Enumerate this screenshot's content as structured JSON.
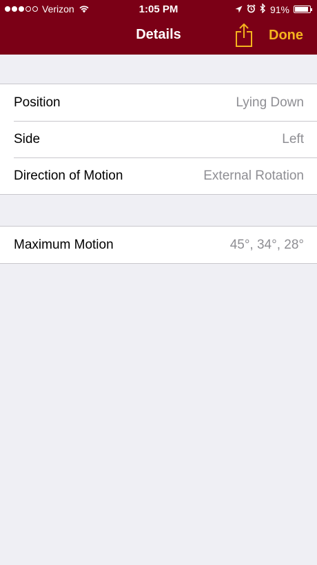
{
  "colors": {
    "nav_bar": "#7b0016",
    "accent": "#f5b41e",
    "background": "#efeff4",
    "value_text": "#8e8e93"
  },
  "status_bar": {
    "carrier": "Verizon",
    "signal_strength": 3,
    "signal_max": 5,
    "time": "1:05 PM",
    "battery": "91%",
    "battery_level": 0.91,
    "icons": [
      "location-icon",
      "alarm-icon",
      "bluetooth-icon"
    ]
  },
  "nav": {
    "title": "Details",
    "share_icon": "share-icon",
    "done_label": "Done"
  },
  "details": {
    "rows": [
      {
        "label": "Position",
        "value": "Lying Down"
      },
      {
        "label": "Side",
        "value": "Left"
      },
      {
        "label": "Direction of Motion",
        "value": "External Rotation"
      }
    ]
  },
  "motion": {
    "rows": [
      {
        "label": "Maximum Motion",
        "value": "45°, 34°, 28°"
      }
    ]
  }
}
